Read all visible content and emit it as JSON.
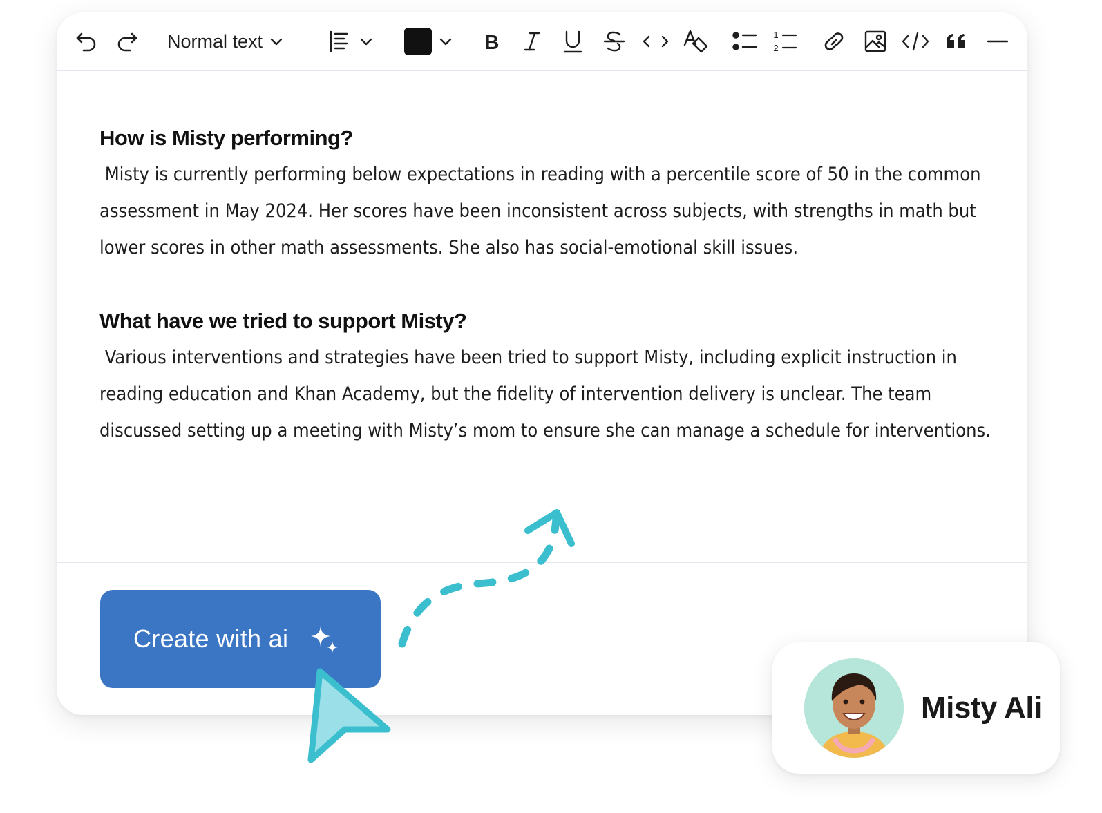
{
  "toolbar": {
    "undo_icon": "undo-icon",
    "redo_icon": "redo-icon",
    "text_style": "Normal text",
    "align_icon": "align-left-icon",
    "text_color": "#111111",
    "tools": [
      "bold-icon",
      "italic-icon",
      "underline-icon",
      "strikethrough-icon",
      "inline-code-icon",
      "clear-format-icon",
      "bullet-list-icon",
      "numbered-list-icon",
      "link-icon",
      "image-icon",
      "code-block-icon",
      "blockquote-icon",
      "horizontal-rule-icon"
    ]
  },
  "document": {
    "section1_heading": "How is Misty performing?",
    "section1_body": " Misty is currently performing below expectations in reading with a percentile score of 50 in the common assessment in May 2024. Her scores have been inconsistent across subjects, with strengths in math but lower scores in other math assessments. She also has social-emotional skill issues.",
    "section2_heading": "What have we tried to support Misty?",
    "section2_body": " Various interventions and strategies have been tried to support Misty, including explicit instruction in reading education and Khan Academy, but the fidelity of intervention delivery is unclear. The team discussed setting up a meeting with Misty’s mom to ensure she can manage a schedule for interventions."
  },
  "actions": {
    "create_ai_label": "Create with ai",
    "create_ai_icon": "sparkles-icon",
    "button_color": "#3b76c4"
  },
  "decor": {
    "accent_color": "#3bbfce",
    "cursor_fill": "#9be0e8"
  },
  "profile": {
    "name": "Misty Ali",
    "avatar_bg": "#b6e6d9"
  }
}
